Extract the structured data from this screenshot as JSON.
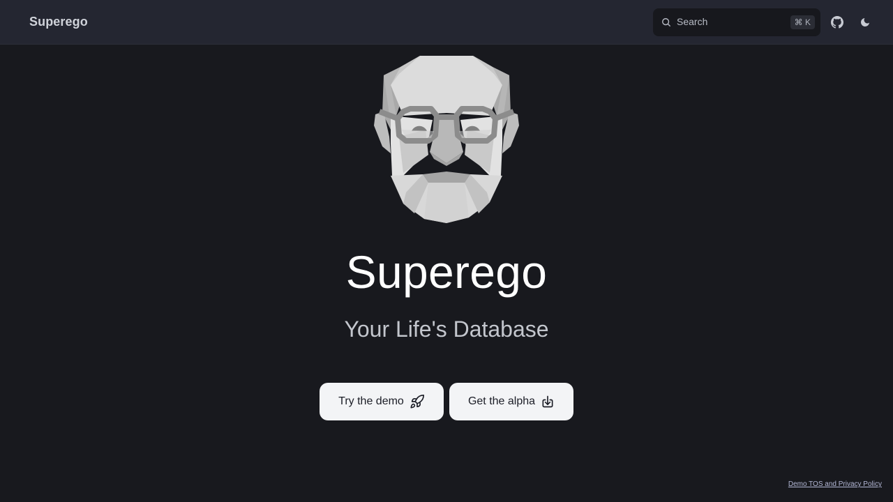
{
  "navbar": {
    "brand": "Superego",
    "search": {
      "label": "Search",
      "shortcut": "⌘ K"
    },
    "icons": [
      "search-icon",
      "github-icon",
      "moon-icon"
    ]
  },
  "hero": {
    "title": "Superego",
    "subtitle": "Your Life's Database",
    "illustration": "superego-face-illustration",
    "buttons": [
      {
        "label": "Try the demo",
        "icon": "rocket-icon"
      },
      {
        "label": "Get the alpha",
        "icon": "download-icon"
      }
    ]
  },
  "footer": {
    "link": "Demo TOS and Privacy Policy"
  },
  "colors": {
    "background": "#18191e",
    "navbar": "#242631",
    "button": "#f3f4f6",
    "title": "#ffffff",
    "subtitle": "#c3c6cd"
  }
}
